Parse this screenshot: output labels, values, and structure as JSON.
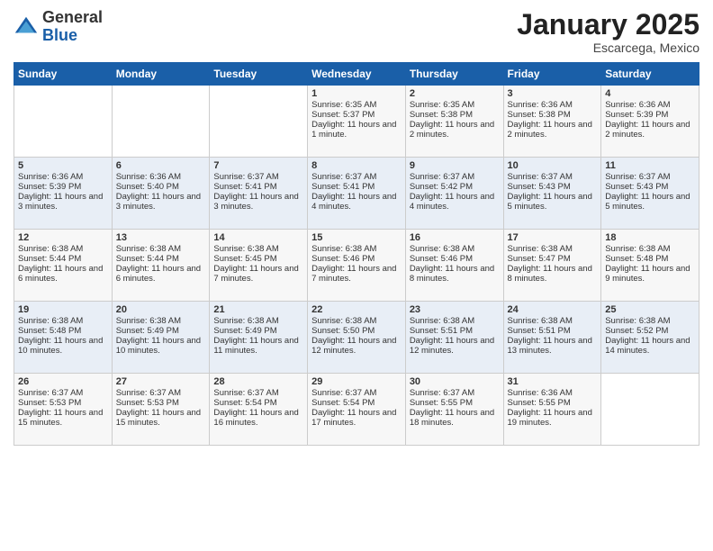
{
  "header": {
    "logo": {
      "general": "General",
      "blue": "Blue"
    },
    "title": "January 2025",
    "subtitle": "Escarcega, Mexico"
  },
  "weekdays": [
    "Sunday",
    "Monday",
    "Tuesday",
    "Wednesday",
    "Thursday",
    "Friday",
    "Saturday"
  ],
  "weeks": [
    [
      {
        "day": "",
        "sunrise": "",
        "sunset": "",
        "daylight": ""
      },
      {
        "day": "",
        "sunrise": "",
        "sunset": "",
        "daylight": ""
      },
      {
        "day": "",
        "sunrise": "",
        "sunset": "",
        "daylight": ""
      },
      {
        "day": "1",
        "sunrise": "Sunrise: 6:35 AM",
        "sunset": "Sunset: 5:37 PM",
        "daylight": "Daylight: 11 hours and 1 minute."
      },
      {
        "day": "2",
        "sunrise": "Sunrise: 6:35 AM",
        "sunset": "Sunset: 5:38 PM",
        "daylight": "Daylight: 11 hours and 2 minutes."
      },
      {
        "day": "3",
        "sunrise": "Sunrise: 6:36 AM",
        "sunset": "Sunset: 5:38 PM",
        "daylight": "Daylight: 11 hours and 2 minutes."
      },
      {
        "day": "4",
        "sunrise": "Sunrise: 6:36 AM",
        "sunset": "Sunset: 5:39 PM",
        "daylight": "Daylight: 11 hours and 2 minutes."
      }
    ],
    [
      {
        "day": "5",
        "sunrise": "Sunrise: 6:36 AM",
        "sunset": "Sunset: 5:39 PM",
        "daylight": "Daylight: 11 hours and 3 minutes."
      },
      {
        "day": "6",
        "sunrise": "Sunrise: 6:36 AM",
        "sunset": "Sunset: 5:40 PM",
        "daylight": "Daylight: 11 hours and 3 minutes."
      },
      {
        "day": "7",
        "sunrise": "Sunrise: 6:37 AM",
        "sunset": "Sunset: 5:41 PM",
        "daylight": "Daylight: 11 hours and 3 minutes."
      },
      {
        "day": "8",
        "sunrise": "Sunrise: 6:37 AM",
        "sunset": "Sunset: 5:41 PM",
        "daylight": "Daylight: 11 hours and 4 minutes."
      },
      {
        "day": "9",
        "sunrise": "Sunrise: 6:37 AM",
        "sunset": "Sunset: 5:42 PM",
        "daylight": "Daylight: 11 hours and 4 minutes."
      },
      {
        "day": "10",
        "sunrise": "Sunrise: 6:37 AM",
        "sunset": "Sunset: 5:43 PM",
        "daylight": "Daylight: 11 hours and 5 minutes."
      },
      {
        "day": "11",
        "sunrise": "Sunrise: 6:37 AM",
        "sunset": "Sunset: 5:43 PM",
        "daylight": "Daylight: 11 hours and 5 minutes."
      }
    ],
    [
      {
        "day": "12",
        "sunrise": "Sunrise: 6:38 AM",
        "sunset": "Sunset: 5:44 PM",
        "daylight": "Daylight: 11 hours and 6 minutes."
      },
      {
        "day": "13",
        "sunrise": "Sunrise: 6:38 AM",
        "sunset": "Sunset: 5:44 PM",
        "daylight": "Daylight: 11 hours and 6 minutes."
      },
      {
        "day": "14",
        "sunrise": "Sunrise: 6:38 AM",
        "sunset": "Sunset: 5:45 PM",
        "daylight": "Daylight: 11 hours and 7 minutes."
      },
      {
        "day": "15",
        "sunrise": "Sunrise: 6:38 AM",
        "sunset": "Sunset: 5:46 PM",
        "daylight": "Daylight: 11 hours and 7 minutes."
      },
      {
        "day": "16",
        "sunrise": "Sunrise: 6:38 AM",
        "sunset": "Sunset: 5:46 PM",
        "daylight": "Daylight: 11 hours and 8 minutes."
      },
      {
        "day": "17",
        "sunrise": "Sunrise: 6:38 AM",
        "sunset": "Sunset: 5:47 PM",
        "daylight": "Daylight: 11 hours and 8 minutes."
      },
      {
        "day": "18",
        "sunrise": "Sunrise: 6:38 AM",
        "sunset": "Sunset: 5:48 PM",
        "daylight": "Daylight: 11 hours and 9 minutes."
      }
    ],
    [
      {
        "day": "19",
        "sunrise": "Sunrise: 6:38 AM",
        "sunset": "Sunset: 5:48 PM",
        "daylight": "Daylight: 11 hours and 10 minutes."
      },
      {
        "day": "20",
        "sunrise": "Sunrise: 6:38 AM",
        "sunset": "Sunset: 5:49 PM",
        "daylight": "Daylight: 11 hours and 10 minutes."
      },
      {
        "day": "21",
        "sunrise": "Sunrise: 6:38 AM",
        "sunset": "Sunset: 5:49 PM",
        "daylight": "Daylight: 11 hours and 11 minutes."
      },
      {
        "day": "22",
        "sunrise": "Sunrise: 6:38 AM",
        "sunset": "Sunset: 5:50 PM",
        "daylight": "Daylight: 11 hours and 12 minutes."
      },
      {
        "day": "23",
        "sunrise": "Sunrise: 6:38 AM",
        "sunset": "Sunset: 5:51 PM",
        "daylight": "Daylight: 11 hours and 12 minutes."
      },
      {
        "day": "24",
        "sunrise": "Sunrise: 6:38 AM",
        "sunset": "Sunset: 5:51 PM",
        "daylight": "Daylight: 11 hours and 13 minutes."
      },
      {
        "day": "25",
        "sunrise": "Sunrise: 6:38 AM",
        "sunset": "Sunset: 5:52 PM",
        "daylight": "Daylight: 11 hours and 14 minutes."
      }
    ],
    [
      {
        "day": "26",
        "sunrise": "Sunrise: 6:37 AM",
        "sunset": "Sunset: 5:53 PM",
        "daylight": "Daylight: 11 hours and 15 minutes."
      },
      {
        "day": "27",
        "sunrise": "Sunrise: 6:37 AM",
        "sunset": "Sunset: 5:53 PM",
        "daylight": "Daylight: 11 hours and 15 minutes."
      },
      {
        "day": "28",
        "sunrise": "Sunrise: 6:37 AM",
        "sunset": "Sunset: 5:54 PM",
        "daylight": "Daylight: 11 hours and 16 minutes."
      },
      {
        "day": "29",
        "sunrise": "Sunrise: 6:37 AM",
        "sunset": "Sunset: 5:54 PM",
        "daylight": "Daylight: 11 hours and 17 minutes."
      },
      {
        "day": "30",
        "sunrise": "Sunrise: 6:37 AM",
        "sunset": "Sunset: 5:55 PM",
        "daylight": "Daylight: 11 hours and 18 minutes."
      },
      {
        "day": "31",
        "sunrise": "Sunrise: 6:36 AM",
        "sunset": "Sunset: 5:55 PM",
        "daylight": "Daylight: 11 hours and 19 minutes."
      },
      {
        "day": "",
        "sunrise": "",
        "sunset": "",
        "daylight": ""
      }
    ]
  ]
}
